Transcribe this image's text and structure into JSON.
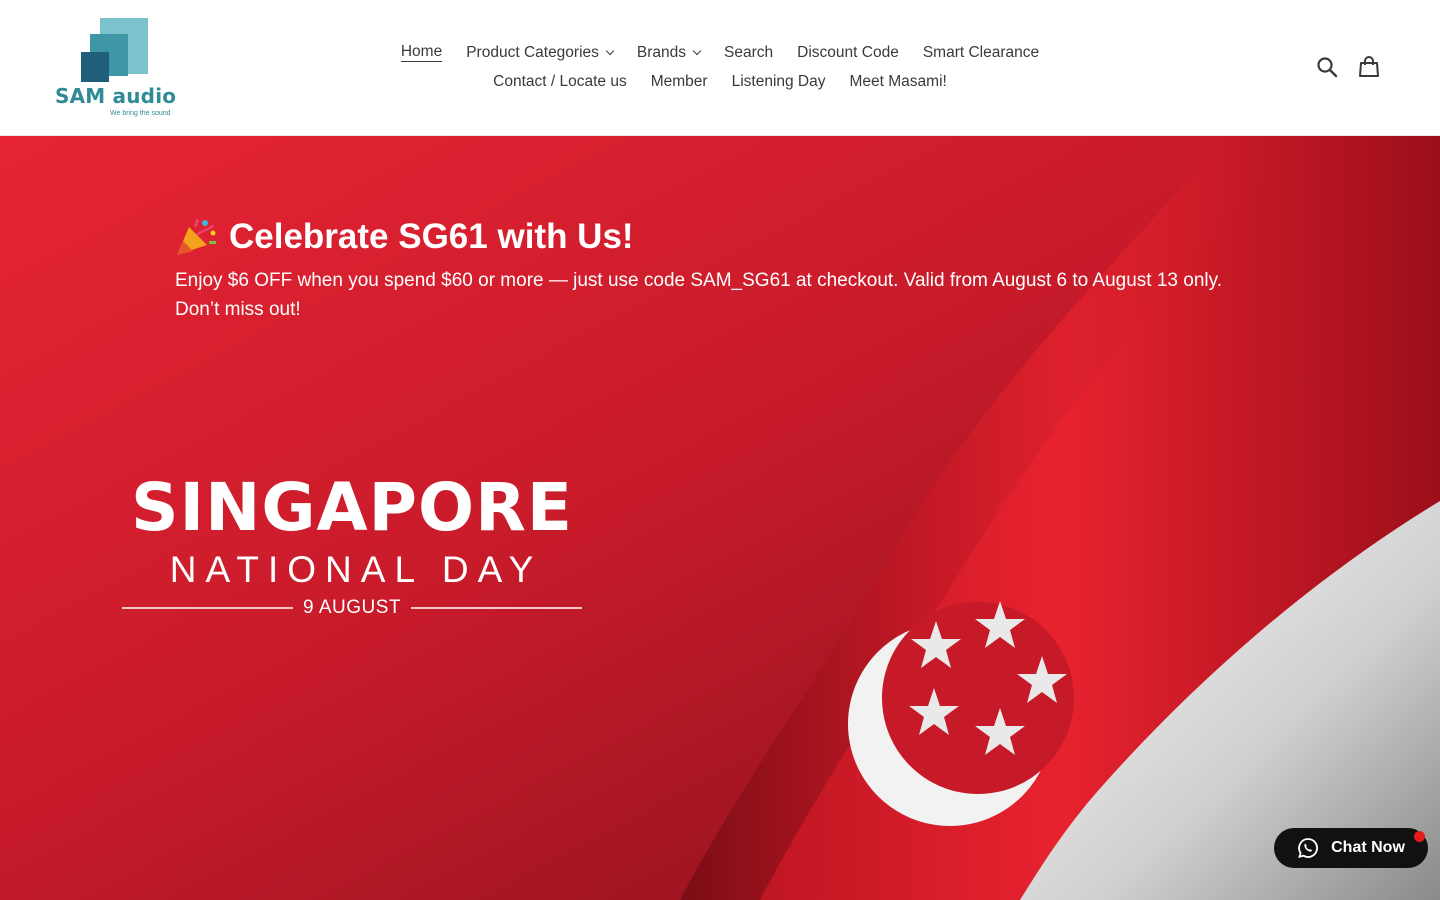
{
  "brand": {
    "name": "SAM audio",
    "tagline": "We bring the sound",
    "color": "#2f8b96"
  },
  "nav": {
    "row1": [
      {
        "label": "Home",
        "active": true,
        "dropdown": false
      },
      {
        "label": "Product Categories",
        "active": false,
        "dropdown": true
      },
      {
        "label": "Brands",
        "active": false,
        "dropdown": true
      },
      {
        "label": "Search",
        "active": false,
        "dropdown": false
      },
      {
        "label": "Discount Code",
        "active": false,
        "dropdown": false
      },
      {
        "label": "Smart Clearance",
        "active": false,
        "dropdown": false
      }
    ],
    "row2": [
      {
        "label": "Contact / Locate us"
      },
      {
        "label": "Member"
      },
      {
        "label": "Listening Day"
      },
      {
        "label": "Meet Masami!"
      }
    ]
  },
  "header_icons": [
    "search-icon",
    "cart-icon"
  ],
  "hero": {
    "promo_title": "Celebrate SG61 with Us!",
    "promo_emoji": "party-popper-icon",
    "promo_body": "Enjoy $6 OFF when you spend $60 or more — just use code SAM_SG61 at checkout. Valid from August 6 to August 13 only. Don’t miss out!",
    "banner_title": "SINGAPORE",
    "banner_subtitle": "NATIONAL DAY",
    "banner_date": "9 AUGUST",
    "colors": {
      "red": "#e3202f",
      "white": "#ffffff"
    }
  },
  "chat": {
    "label": "Chat Now",
    "icon": "whatsapp-icon",
    "dot_color": "#e31b1b"
  }
}
